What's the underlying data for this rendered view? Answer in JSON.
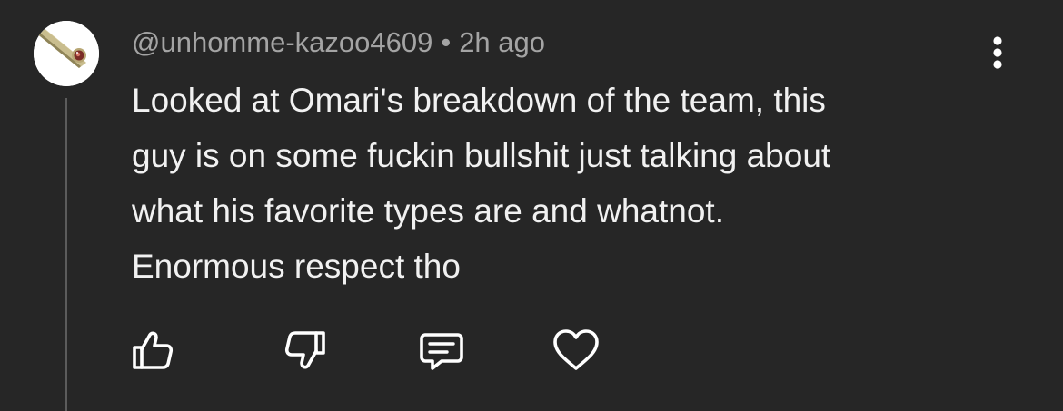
{
  "comment": {
    "username": "@unhomme-kazoo4609",
    "separator": "•",
    "timestamp": "2h ago",
    "lines": [
      "Looked at Omari's breakdown of the team, this",
      "guy is on some fuckin bullshit just talking about",
      "what his favorite types are and whatnot.",
      "Enormous respect tho"
    ]
  },
  "icons": {
    "avatar": "kazoo-avatar-icon",
    "more": "vertical-dots-icon",
    "like": "thumbs-up-icon",
    "dislike": "thumbs-down-icon",
    "reply": "comment-icon",
    "heart": "heart-icon"
  },
  "colors": {
    "background": "#262626",
    "text": "#f1f1f1",
    "meta": "#a4a4a4",
    "thread_line": "#5b5b5b"
  }
}
